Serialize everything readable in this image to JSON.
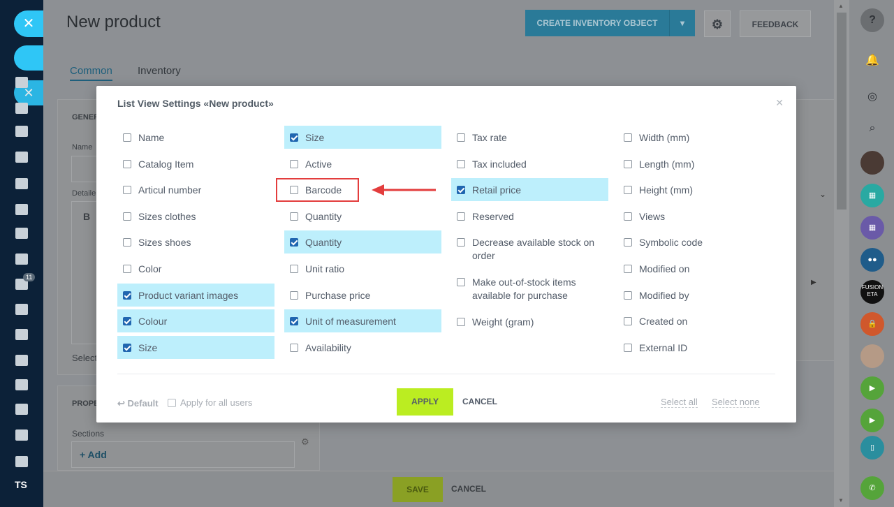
{
  "page": {
    "title": "New product",
    "create_button": "CREATE INVENTORY OBJECT",
    "feedback_button": "FEEDBACK",
    "tabs": [
      "Common",
      "Inventory"
    ],
    "general_label": "GENER",
    "name_label": "Name",
    "details_label": "Detaile",
    "bold_glyph": "B",
    "select_label": "Select",
    "properties_label": "PROPE",
    "sections_label": "Sections",
    "add_label": "+ Add",
    "save_button": "SAVE",
    "cancel_button": "CANCEL"
  },
  "leftnav": {
    "badge": "11",
    "user_initials": "TS"
  },
  "modal": {
    "title": "List View Settings «New product»",
    "columns": [
      [
        {
          "label": "Name",
          "checked": false
        },
        {
          "label": "Catalog Item",
          "checked": false
        },
        {
          "label": "Articul number",
          "checked": false
        },
        {
          "label": "Sizes clothes",
          "checked": false
        },
        {
          "label": "Sizes shoes",
          "checked": false
        },
        {
          "label": "Color",
          "checked": false
        },
        {
          "label": "Product variant images",
          "checked": true
        },
        {
          "label": "Colour",
          "checked": true
        },
        {
          "label": "Size",
          "checked": true
        }
      ],
      [
        {
          "label": "Size",
          "checked": true
        },
        {
          "label": "Active",
          "checked": false
        },
        {
          "label": "Barcode",
          "checked": false
        },
        {
          "label": "Quantity",
          "checked": false
        },
        {
          "label": "Quantity",
          "checked": true
        },
        {
          "label": "Unit ratio",
          "checked": false
        },
        {
          "label": "Purchase price",
          "checked": false
        },
        {
          "label": "Unit of measurement",
          "checked": true
        },
        {
          "label": "Availability",
          "checked": false
        }
      ],
      [
        {
          "label": "Tax rate",
          "checked": false
        },
        {
          "label": "Tax included",
          "checked": false
        },
        {
          "label": "Retail price",
          "checked": true
        },
        {
          "label": "Reserved",
          "checked": false
        },
        {
          "label": "Decrease available stock on order",
          "checked": false
        },
        {
          "label": "Make out-of-stock items available for purchase",
          "checked": false
        },
        {
          "label": "Weight (gram)",
          "checked": false
        }
      ],
      [
        {
          "label": "Width (mm)",
          "checked": false
        },
        {
          "label": "Length (mm)",
          "checked": false
        },
        {
          "label": "Height (mm)",
          "checked": false
        },
        {
          "label": "Views",
          "checked": false
        },
        {
          "label": "Symbolic code",
          "checked": false
        },
        {
          "label": "Modified on",
          "checked": false
        },
        {
          "label": "Modified by",
          "checked": false
        },
        {
          "label": "Created on",
          "checked": false
        },
        {
          "label": "External ID",
          "checked": false
        }
      ]
    ],
    "footer": {
      "default_link": "Default",
      "apply_all_users": "Apply for all users",
      "apply_button": "APPLY",
      "cancel_button": "CANCEL",
      "select_all": "Select all",
      "select_none": "Select none"
    }
  },
  "rightrail": {
    "fusion_label": "FUSION ETA"
  },
  "colors": {
    "accent": "#2fc6f6",
    "apply": "#bbed21",
    "checked_bg": "#bdeffc",
    "checkbox": "#2066b0",
    "annotation": "#e33d3d"
  }
}
